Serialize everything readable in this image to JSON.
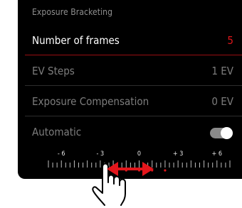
{
  "header": {
    "title": "Exposure Bracketing"
  },
  "menu": [
    {
      "label": "Number of frames",
      "value": "5",
      "selected": true
    },
    {
      "label": "EV Steps",
      "value": "1 EV",
      "selected": false
    },
    {
      "label": "Exposure Compensation",
      "value": "0 EV",
      "selected": false
    },
    {
      "label": "Automatic",
      "value": "",
      "toggle": true,
      "toggle_on": true,
      "selected": false
    }
  ],
  "scale": {
    "labels": [
      "- 6",
      "- 3",
      "0",
      "+ 3",
      "+ 6"
    ],
    "range": [
      -7,
      7
    ],
    "bracket_marks_ev": [
      -2,
      -1,
      0,
      1,
      2
    ]
  },
  "colors": {
    "accent_red": "#e0161b",
    "arrow_red": "#e3161c",
    "text_dim": "#7d7d7d",
    "text_active": "#ffffff"
  },
  "icons": {
    "hand": "hand-pointer-icon",
    "arrow": "double-headed-arrow-icon"
  }
}
